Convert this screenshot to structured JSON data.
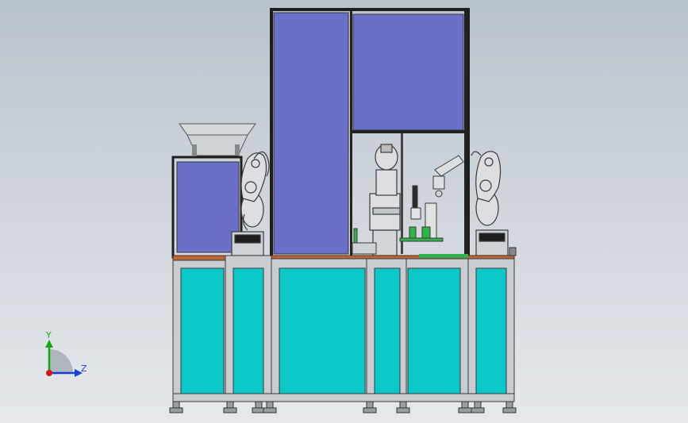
{
  "triad": {
    "y_label": "Y",
    "z_label": "Z",
    "y_color": "#1aa31a",
    "z_color": "#1b3fd6",
    "x_color": "#cc1a1a"
  },
  "colors": {
    "background_top": "#b9c3cc",
    "background_bottom": "#e6e8ec",
    "enclosure_panel": "#6b6fca",
    "cabinet_panel": "#0cc8c8",
    "frame": "#c9ccd0",
    "frame_edge": "#2b2b2b",
    "tabletop": "#b9683a",
    "robot": "#d8dadd",
    "green_part": "#2fb34a"
  }
}
